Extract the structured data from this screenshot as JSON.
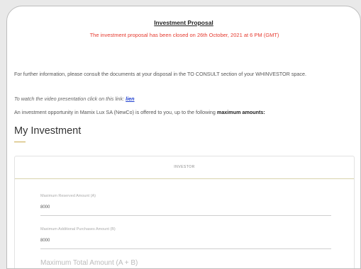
{
  "proposal": {
    "title": "Investment Proposal",
    "closed_notice": "The investment proposal has been closed on 26th October, 2021 at 6 PM (GMT)",
    "info_text": "For further information, please consult the documents at your disposal in the TO CONSULT section of your WHINVESTOR space.",
    "video_text": "To watch the video presentation click on this link:",
    "video_link": "lien",
    "opportunity_text": "An investment opportunity in Mamix Lux SA (NewCo) is offered to you, up to the following",
    "opportunity_bold": "maximum amounts:"
  },
  "investment": {
    "heading": "My Investment",
    "form_header": "INVESTOR",
    "fields": [
      {
        "label": "Maximum Reserved Amount (A)",
        "value": "8000"
      },
      {
        "label": "Maximum Additional Purchases Amount (B)",
        "value": "8000"
      }
    ],
    "total_label": "Maximum Total Amount (A + B)"
  },
  "colors": {
    "notice": "#e53a2f",
    "link": "#1e3fd0",
    "accent": "#c9a94a"
  }
}
